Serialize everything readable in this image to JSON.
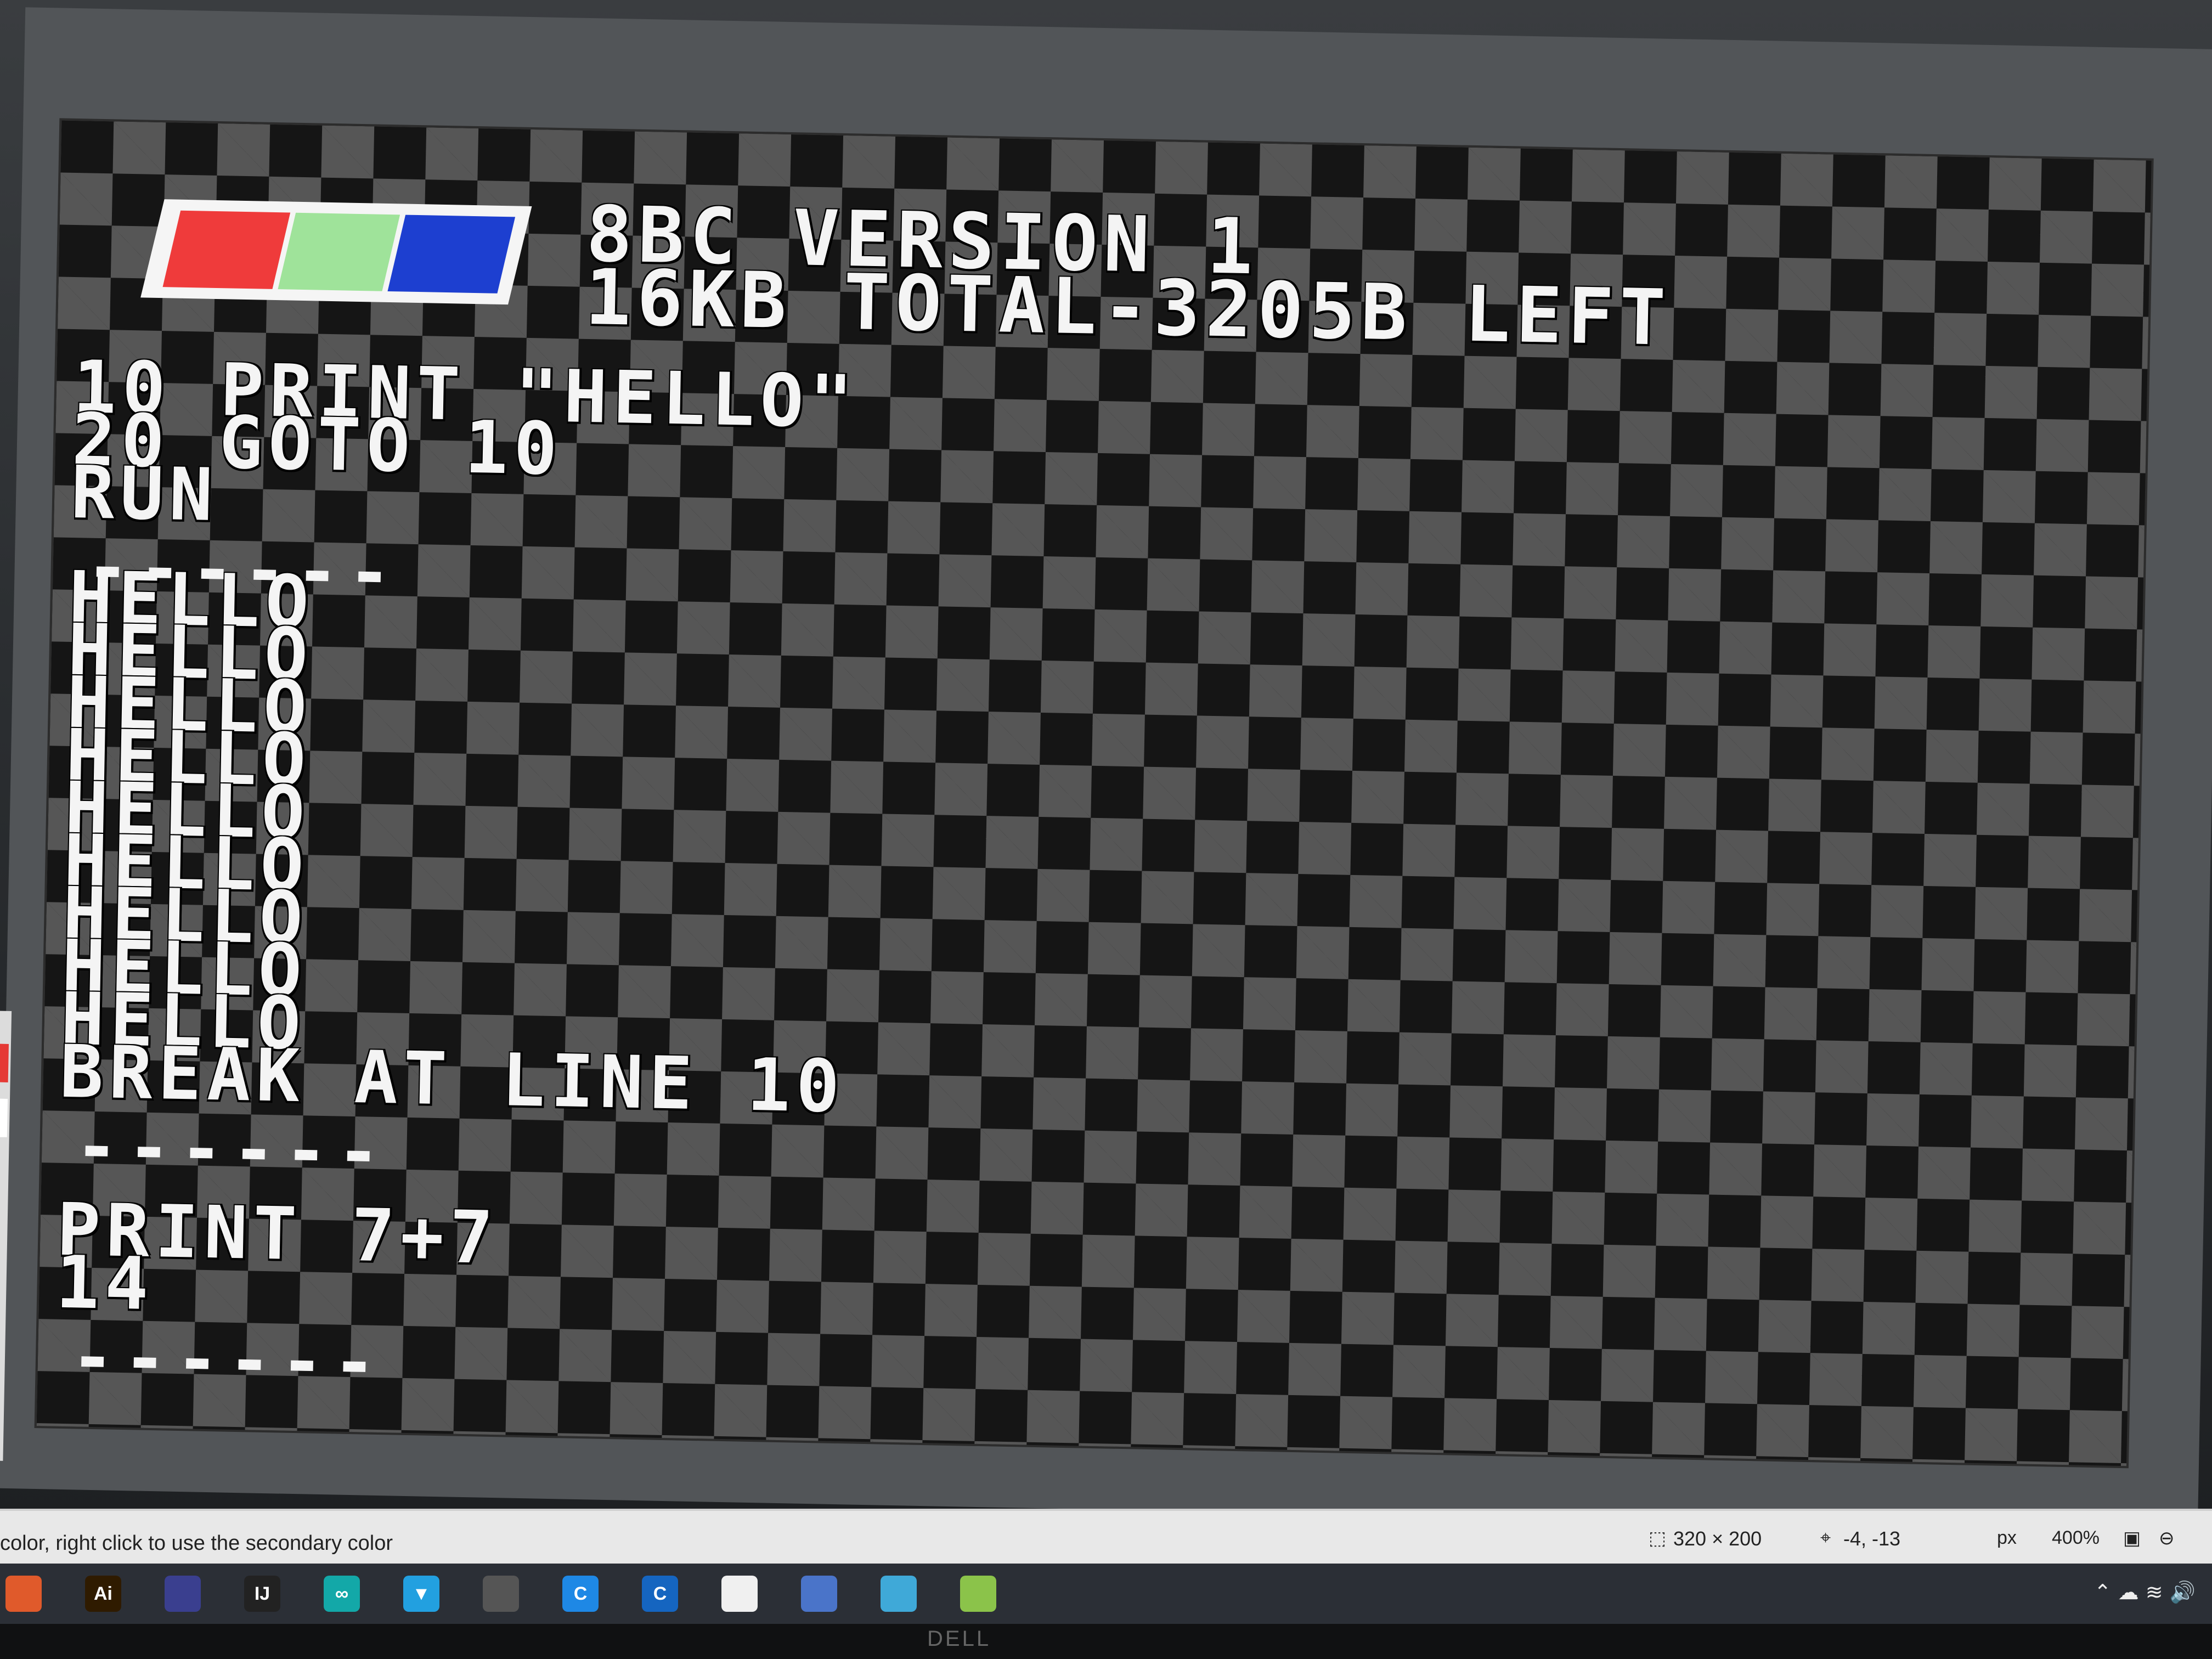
{
  "screen": {
    "header_line1": "8BC VERSION 1",
    "header_line2": "16KB TOTAL-3205B LEFT",
    "logo_colors": [
      "#ef3b3b",
      "#9fe39a",
      "#1d3fd0"
    ],
    "lines": [
      {
        "kind": "text",
        "text": "10 PRINT \"HELLO\""
      },
      {
        "kind": "text",
        "text": "20 GOTO 10"
      },
      {
        "kind": "text",
        "text": "RUN"
      },
      {
        "kind": "sep",
        "text": "------"
      },
      {
        "kind": "text",
        "text": "HELLO"
      },
      {
        "kind": "text",
        "text": "HELLO"
      },
      {
        "kind": "text",
        "text": "HELLO"
      },
      {
        "kind": "text",
        "text": "HELLO"
      },
      {
        "kind": "text",
        "text": "HELLO"
      },
      {
        "kind": "text",
        "text": "HELLO"
      },
      {
        "kind": "text",
        "text": "HELLO"
      },
      {
        "kind": "text",
        "text": "HELLO"
      },
      {
        "kind": "text",
        "text": "HELLO"
      },
      {
        "kind": "text",
        "text": "BREAK AT LINE 10"
      },
      {
        "kind": "sep",
        "text": "------"
      },
      {
        "kind": "gap",
        "text": ""
      },
      {
        "kind": "text",
        "text": "PRINT 7+7"
      },
      {
        "kind": "text",
        "text": "14"
      },
      {
        "kind": "sep",
        "text": "------"
      }
    ]
  },
  "status_bar": {
    "hint": "color, right click to use the secondary color",
    "canvas_size": "320 × 200",
    "cursor_position": "-4, -13",
    "unit": "px",
    "zoom": "400%"
  },
  "taskbar": {
    "icons": [
      {
        "name": "app-icon-1",
        "color": "#e05a2b",
        "label": ""
      },
      {
        "name": "illustrator-icon",
        "color": "#2f1b00",
        "label": "Ai"
      },
      {
        "name": "app-icon-3",
        "color": "#3a3f8f",
        "label": ""
      },
      {
        "name": "intellij-icon",
        "color": "#222222",
        "label": "IJ"
      },
      {
        "name": "arduino-icon",
        "color": "#13a8a8",
        "label": "∞"
      },
      {
        "name": "app-icon-6",
        "color": "#22a0e0",
        "label": "▼"
      },
      {
        "name": "inkscape-icon",
        "color": "#555555",
        "label": ""
      },
      {
        "name": "cortana-icon",
        "color": "#1e88e5",
        "label": "C"
      },
      {
        "name": "chrome-canary-icon",
        "color": "#1565c0",
        "label": "C"
      },
      {
        "name": "app-icon-10",
        "color": "#f0f0f0",
        "label": ""
      },
      {
        "name": "paint-icon",
        "color": "#4a74c9",
        "label": ""
      },
      {
        "name": "app-icon-12",
        "color": "#3fa9d8",
        "label": ""
      },
      {
        "name": "notepad-icon",
        "color": "#8bc34a",
        "label": ""
      }
    ],
    "brand": "DELL"
  }
}
